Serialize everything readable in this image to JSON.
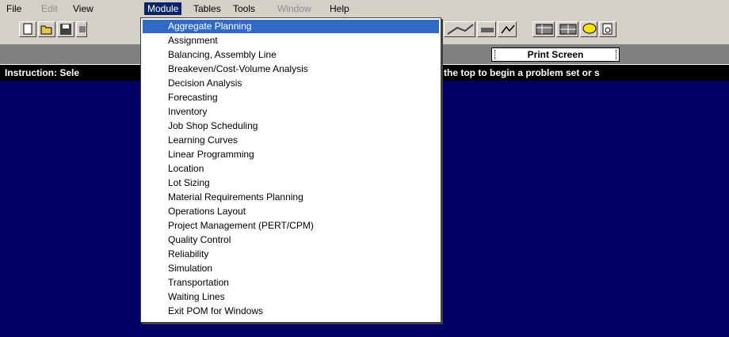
{
  "menubar": {
    "items": [
      {
        "label": "File",
        "state": "normal"
      },
      {
        "label": "Edit",
        "state": "disabled"
      },
      {
        "label": "View",
        "state": "normal"
      },
      {
        "label": "Module",
        "state": "active"
      },
      {
        "label": "Tables",
        "state": "normal"
      },
      {
        "label": "Tools",
        "state": "normal"
      },
      {
        "label": "Window",
        "state": "disabled"
      },
      {
        "label": "Help",
        "state": "normal"
      }
    ]
  },
  "toolbar": {
    "buttons": [
      "new-file-icon",
      "open-folder-icon",
      "save-icon",
      "print-icon",
      "line-chart-icon",
      "mm-icon",
      "graph-icon",
      "table-icon",
      "table-2-icon",
      "help-bubble-icon",
      "print-preview-icon"
    ]
  },
  "strip": {
    "print_button": "Print Screen"
  },
  "instruction": {
    "left_text": "Instruction: Sele",
    "right_text": "the top to begin a problem set or s"
  },
  "module_menu": {
    "items": [
      "Aggregate Planning",
      "Assignment",
      "Balancing, Assembly Line",
      "Breakeven/Cost-Volume Analysis",
      "Decision Analysis",
      "Forecasting",
      "Inventory",
      "Job Shop Scheduling",
      "Learning Curves",
      "Linear Programming",
      "Location",
      "Lot Sizing",
      "Material Requirements Planning",
      "Operations Layout",
      "Project Management (PERT/CPM)",
      "Quality Control",
      "Reliability",
      "Simulation",
      "Transportation",
      "Waiting Lines",
      "Exit POM for Windows"
    ],
    "selected_index": 0
  },
  "colors": {
    "menubar_bg": "#d4d0c8",
    "main_bg": "#000066",
    "selection": "#316ac5"
  }
}
